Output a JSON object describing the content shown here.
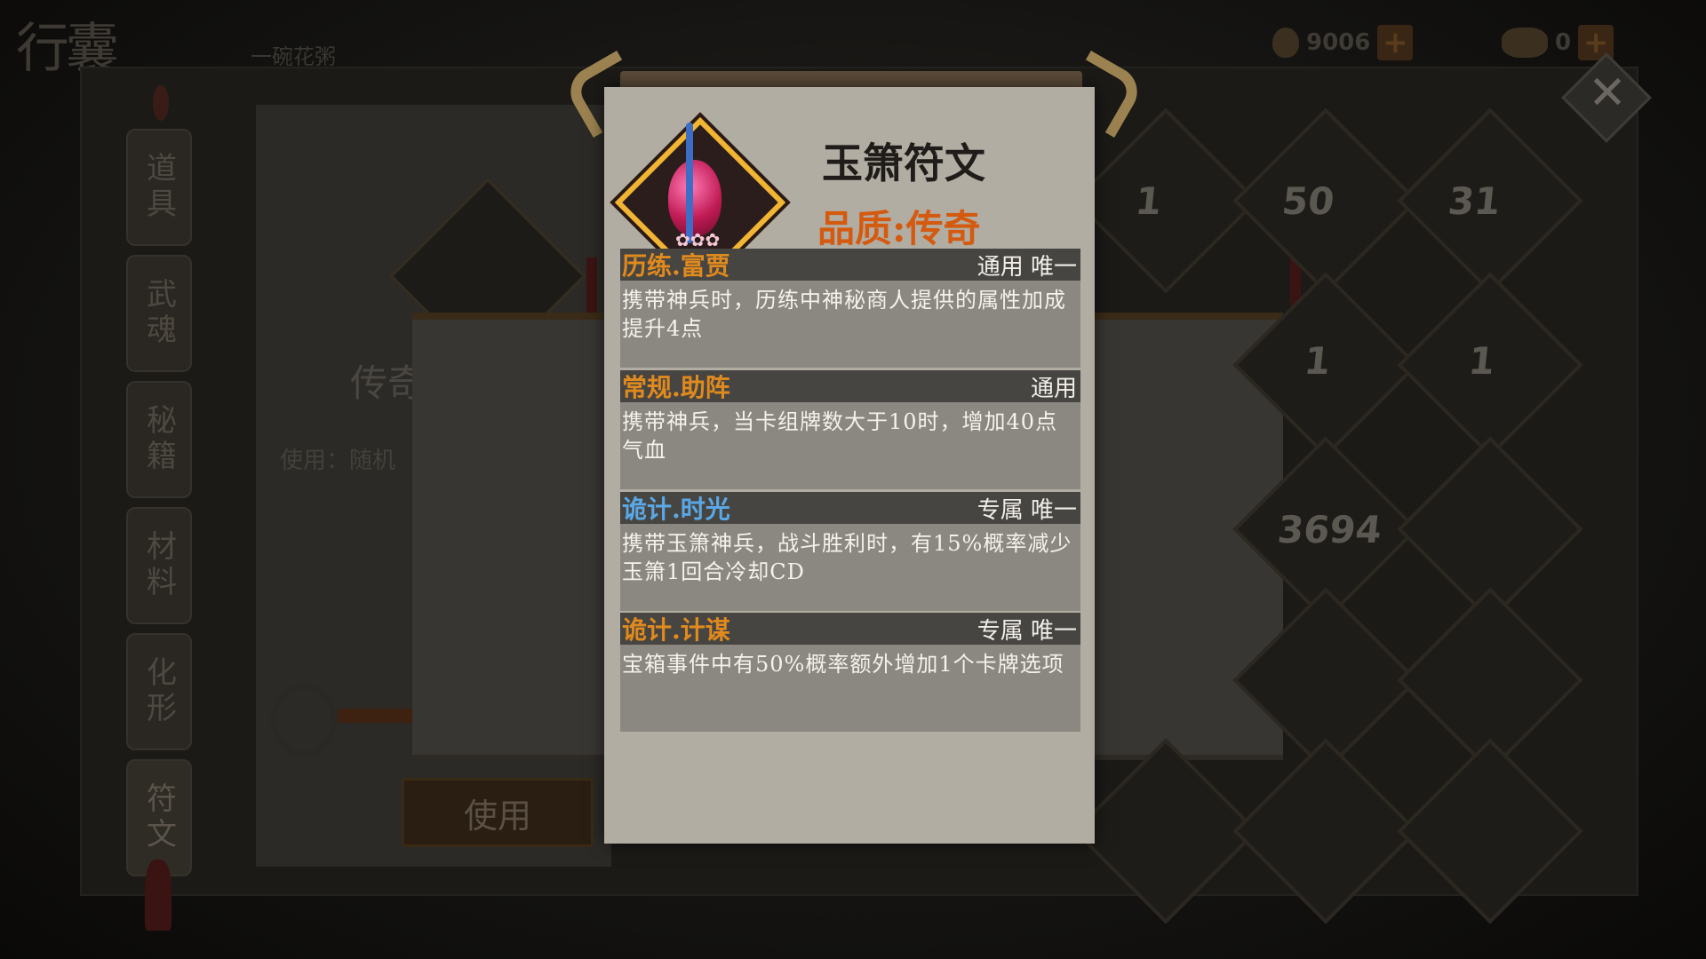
{
  "app_title": "行囊",
  "character_name": "一碗花粥",
  "currencies": [
    {
      "icon": "gold-leaf-icon",
      "value": "9006"
    },
    {
      "icon": "ingot-icon",
      "value": "0"
    }
  ],
  "tabs": [
    "道具",
    "武魂",
    "秘籍",
    "材料",
    "化形",
    "符文"
  ],
  "active_tab": "符文",
  "detail": {
    "title": "传奇",
    "use_text": "使用：随机",
    "use_button": "使用"
  },
  "grid_counts": [
    "1",
    "50",
    "31",
    "1",
    "1",
    "3694"
  ],
  "tooltip": {
    "item_name": "玉箫符文",
    "quality": "品质:传奇",
    "attributes": [
      {
        "name": "历练.富贾",
        "name_color": "#e08a1e",
        "tags": "通用 唯一",
        "desc": "携带神兵时，历练中神秘商人提供的属性加成提升4点"
      },
      {
        "name": "常规.助阵",
        "name_color": "#e08a1e",
        "tags": "通用",
        "desc": "携带神兵，当卡组牌数大于10时，增加40点气血"
      },
      {
        "name": "诡计.时光",
        "name_color": "#5aa8e6",
        "tags": "专属 唯一",
        "desc": "携带玉箫神兵，战斗胜利时，有15%概率减少玉箫1回合冷却CD"
      },
      {
        "name": "诡计.计谋",
        "name_color": "#e08a1e",
        "tags": "专属 唯一",
        "desc": "宝箱事件中有50%概率额外增加1个卡牌选项"
      }
    ]
  },
  "colors": {
    "quality": "#d45a10",
    "icon_border": "#f1b533"
  }
}
